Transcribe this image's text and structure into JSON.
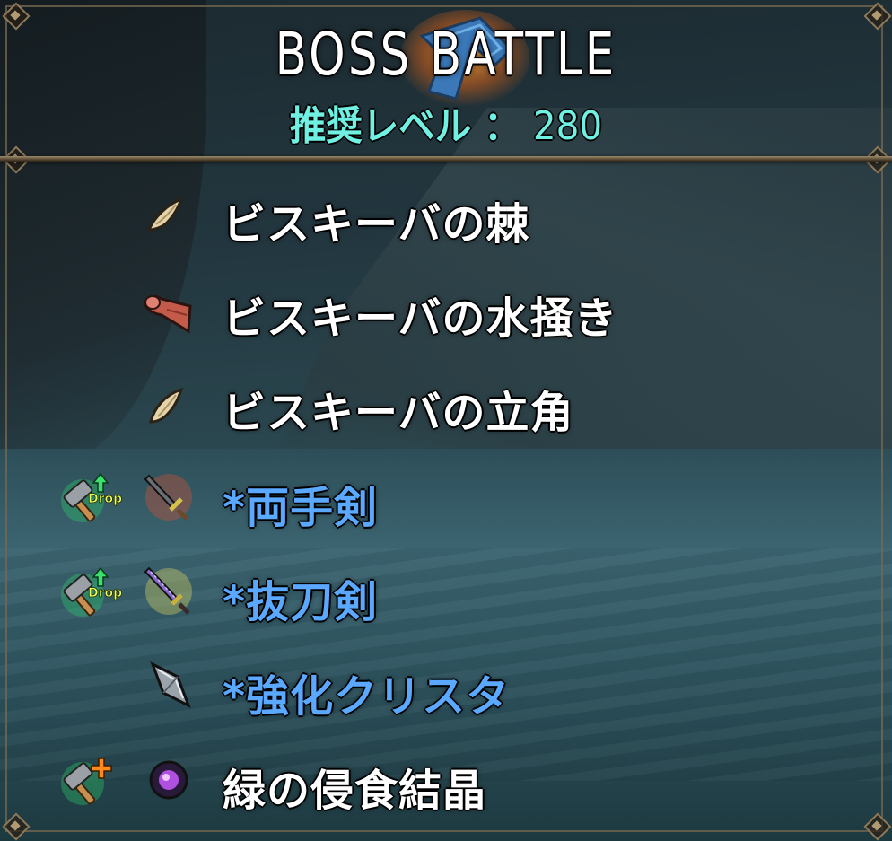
{
  "header": {
    "title": "BOSS BATTLE",
    "level_label": "推奨レベル",
    "level_separator": "：",
    "level_value": "280"
  },
  "drops": [
    {
      "name": "ビスキーバの棘",
      "color": "white",
      "item_icon": "claw-icon",
      "drop_icon": null
    },
    {
      "name": "ビスキーバの水掻き",
      "color": "white",
      "item_icon": "cloth-icon",
      "drop_icon": null
    },
    {
      "name": "ビスキーバの立角",
      "color": "white",
      "item_icon": "horn-icon",
      "drop_icon": null
    },
    {
      "name": "*両手剣",
      "color": "blue",
      "item_icon": "greatsword-icon",
      "drop_icon": "hammer-drop-up-icon",
      "drop_badge": "Drop"
    },
    {
      "name": "*抜刀剣",
      "color": "blue",
      "item_icon": "katana-icon",
      "drop_icon": "hammer-drop-up-icon",
      "drop_badge": "Drop"
    },
    {
      "name": "*強化クリスタ",
      "color": "blue",
      "item_icon": "crysta-icon",
      "drop_icon": null
    },
    {
      "name": "緑の侵食結晶",
      "color": "white",
      "item_icon": "purple-orb-icon",
      "drop_icon": "hammer-plus-icon"
    }
  ],
  "colors": {
    "title": "#ffffff",
    "level": "#6ff0e2",
    "item_white": "#ffffff",
    "item_blue": "#5aa8ff",
    "frame": "#8d7a5a"
  }
}
